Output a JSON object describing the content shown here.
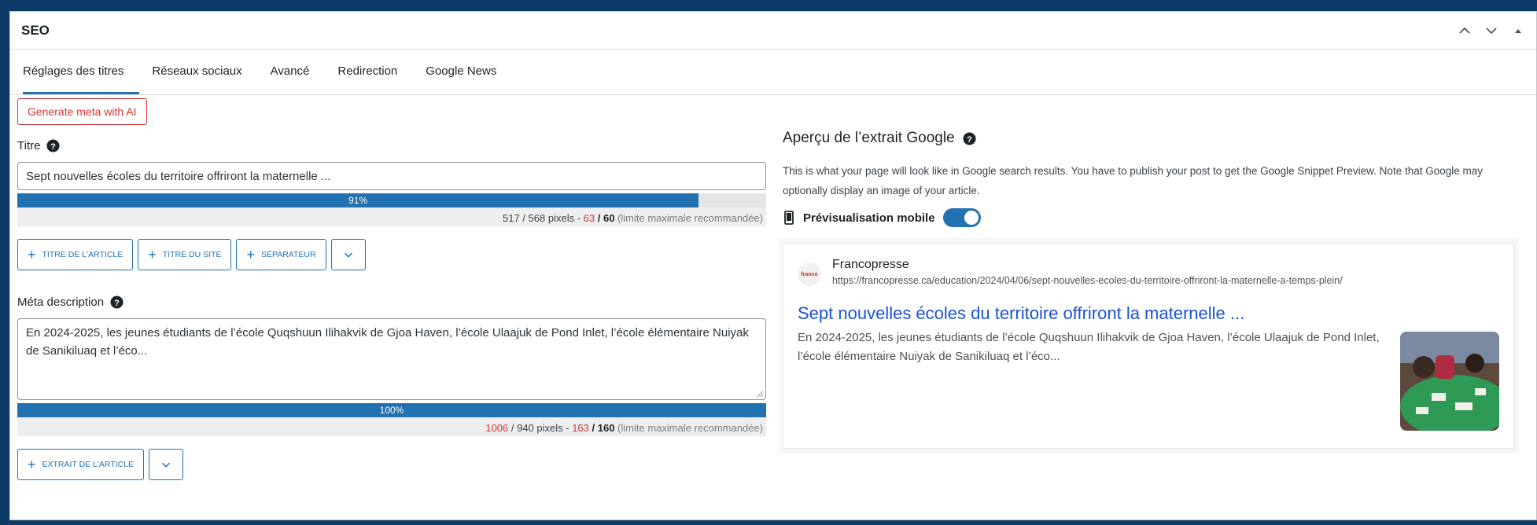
{
  "panel": {
    "title": "SEO",
    "controls": [
      "chevron-up-icon",
      "chevron-down-icon",
      "triangle-up-icon"
    ]
  },
  "tabs": [
    {
      "label": "Réglages des titres",
      "active": true
    },
    {
      "label": "Réseaux sociaux",
      "active": false
    },
    {
      "label": "Avancé",
      "active": false
    },
    {
      "label": "Redirection",
      "active": false
    },
    {
      "label": "Google News",
      "active": false
    }
  ],
  "left": {
    "ai_button": "Generate meta with AI",
    "title_field": {
      "label": "Titre",
      "value": "Sept nouvelles écoles du territoire offriront la maternelle ...",
      "progress_label": "91%",
      "progress": 0.91,
      "pixels": "517 / 568 pixels",
      "sep": " - ",
      "chars_over": "63",
      "chars_limit": " / 60",
      "note": " (limite maximale recommandée)"
    },
    "title_buttons": [
      "Titre de l'article",
      "Titre du site",
      "Séparateur"
    ],
    "meta_field": {
      "label": "Méta description",
      "value": "En 2024-2025, les jeunes étudiants de l’école Quqshuun Ilihakvik de Gjoa Haven, l’école Ulaajuk de Pond Inlet, l’école élémentaire Nuiyak de Sanikiluaq et l’éco...",
      "progress_label": "100%",
      "progress": 1.0,
      "pixels_over": "1006",
      "pixels_rest": " / 940 pixels",
      "sep": " - ",
      "chars_over": "163",
      "chars_limit": " / 160",
      "note": " (limite maximale recommandée)"
    },
    "meta_buttons": [
      "Extrait de l'article"
    ]
  },
  "right": {
    "title": "Aperçu de l’extrait Google",
    "description": "This is what your page will look like in Google search results. You have to publish your post to get the Google Snippet Preview. Note that Google may optionally display an image of your article.",
    "mobile_label": "Prévisualisation mobile",
    "mobile_on": true,
    "snippet": {
      "favicon_text": "franco",
      "site_name": "Francopresse",
      "url": "https://francopresse.ca/education/2024/04/06/sept-nouvelles-ecoles-du-territoire-offriront-la-maternelle-a-temps-plein/",
      "title": "Sept nouvelles écoles du territoire offriront la maternelle ...",
      "description": "En 2024-2025, les jeunes étudiants de l’école Quqshuun Ilihakvik de Gjoa Haven, l’école Ulaajuk de Pond Inlet, l’école élémentaire Nuiyak de Sanikiluaq et l’éco..."
    }
  },
  "colors": {
    "accent": "#2271b1",
    "danger": "#d63638",
    "background": "#0d3a66",
    "link": "#1a53d6"
  }
}
